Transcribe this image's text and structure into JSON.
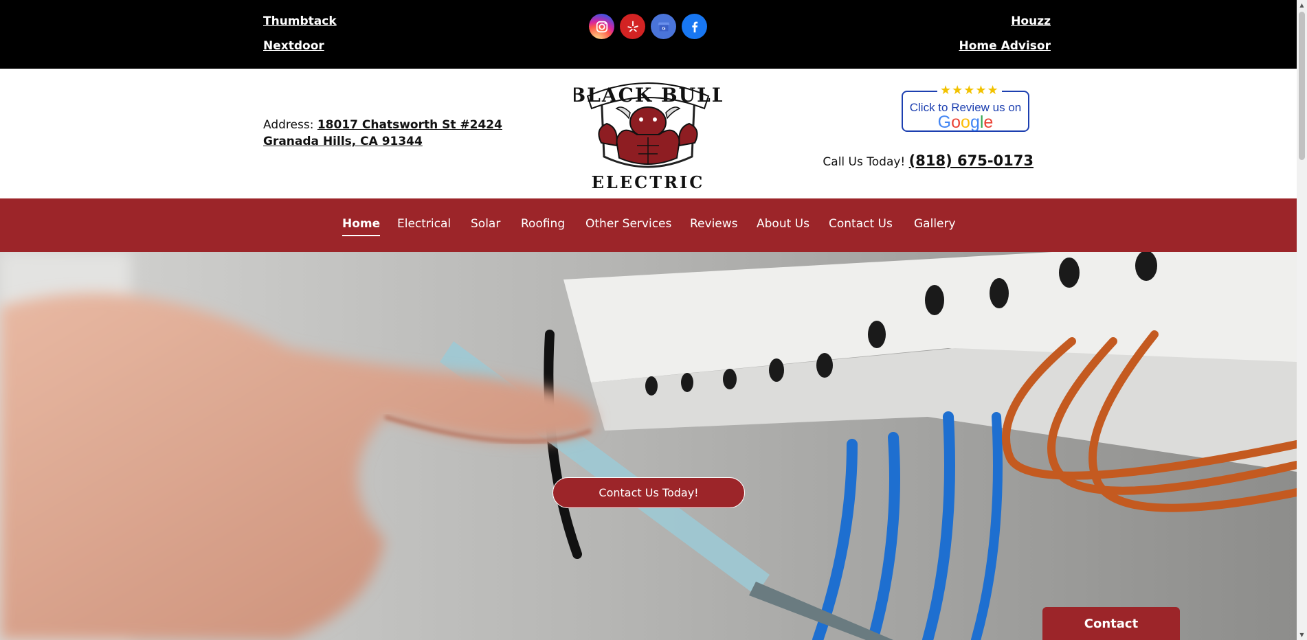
{
  "topbar": {
    "left_links": [
      "Thumbtack",
      "Nextdoor"
    ],
    "right_links": [
      "Houzz",
      "Home Advisor"
    ],
    "social_icons": [
      {
        "name": "instagram-icon",
        "color": "#e1306c"
      },
      {
        "name": "yelp-icon",
        "color": "#d32323"
      },
      {
        "name": "google-business-icon",
        "color": "#4a74d9"
      },
      {
        "name": "facebook-icon",
        "color": "#1877f2"
      }
    ]
  },
  "header": {
    "address_label": "Address:",
    "address_line1": "18017 Chatsworth St #2424",
    "address_line2": "Granada Hills, CA 91344",
    "logo_top": "BLACK BULL",
    "logo_bottom": "ELECTRIC",
    "review_stars": "★★★★★",
    "review_text": "Click to Review us on",
    "review_brand": "Google",
    "call_label": "Call Us Today!",
    "phone": "(818) 675-0173"
  },
  "nav": {
    "items": [
      "Home",
      "Electrical",
      "Solar",
      "Roofing",
      "Other Services",
      "Reviews",
      "About Us",
      "Contact Us",
      "Gallery"
    ],
    "active": "Home"
  },
  "hero": {
    "cta_label": "Contact Us Today!"
  },
  "contact_tab": {
    "label": "Contact"
  },
  "colors": {
    "brand_red": "#9c2529",
    "top_bar": "#000000"
  }
}
